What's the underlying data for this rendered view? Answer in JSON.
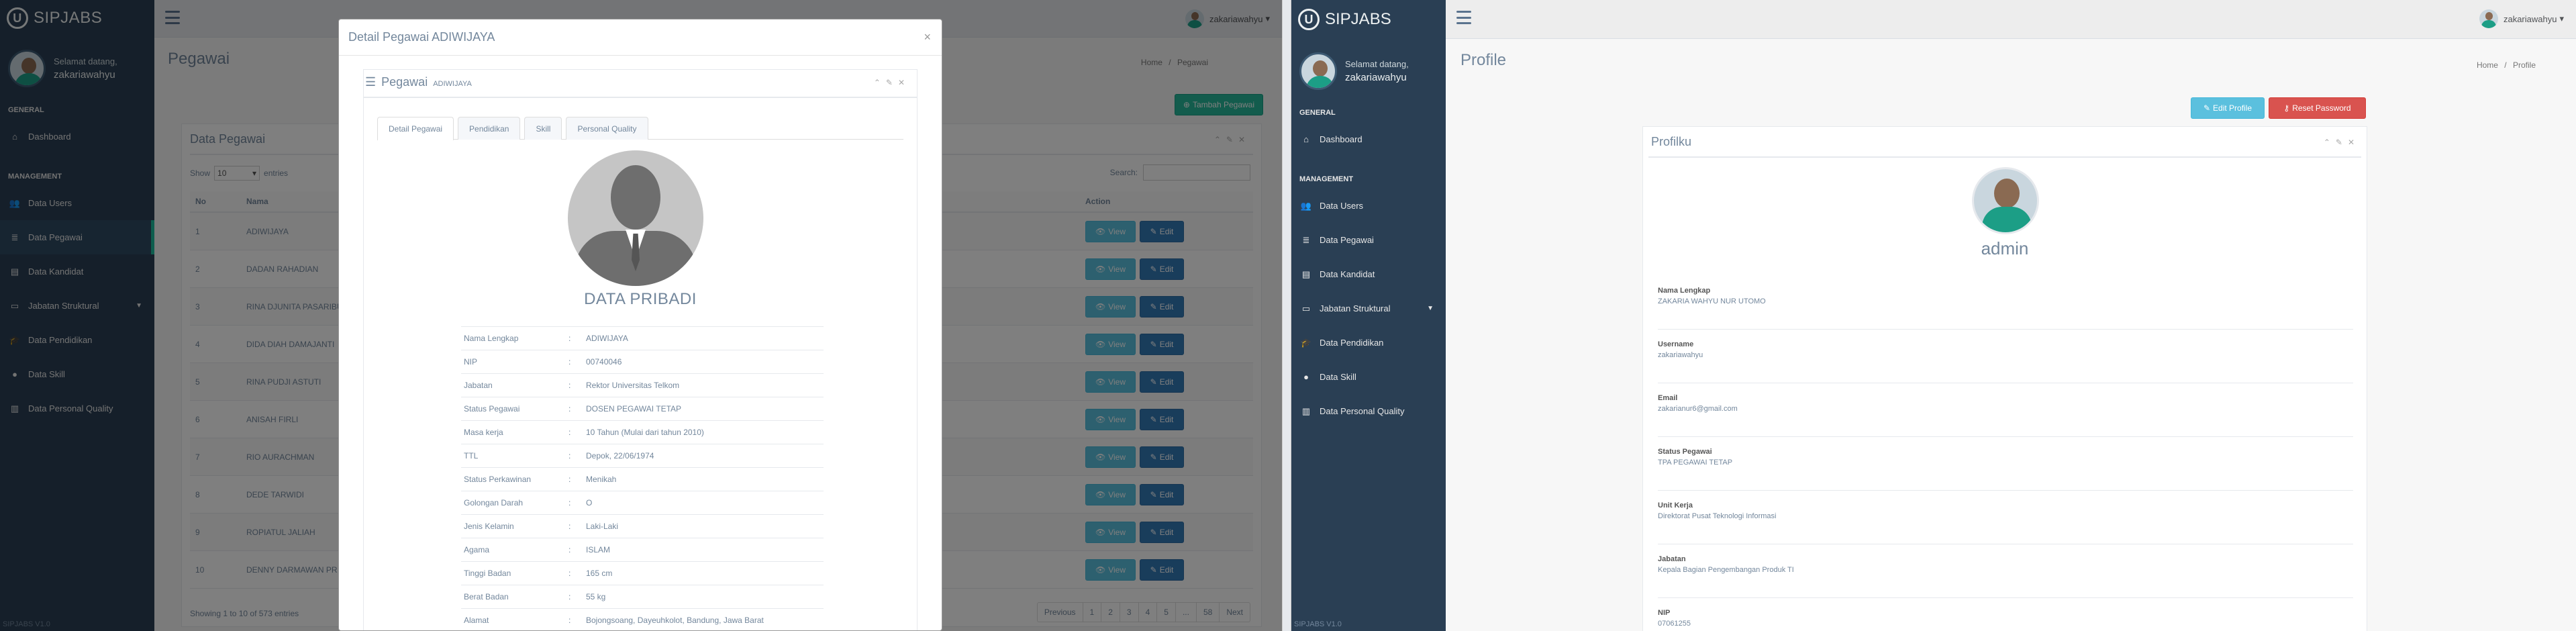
{
  "app": {
    "brand": "SIPJABS",
    "logo_letter": "U",
    "version": "SIPJABS V1.0",
    "welcome": "Selamat datang,",
    "username": "zakariawahyu"
  },
  "sidebar": {
    "section_general": "GENERAL",
    "section_management": "MANAGEMENT",
    "items": [
      {
        "label": "Dashboard",
        "icon": "home-icon"
      },
      {
        "label": "Data Users",
        "icon": "users-icon"
      },
      {
        "label": "Data Pegawai",
        "icon": "database-icon"
      },
      {
        "label": "Data Kandidat",
        "icon": "table-icon"
      },
      {
        "label": "Jabatan Struktural",
        "icon": "desktop-icon"
      },
      {
        "label": "Data Pendidikan",
        "icon": "graduation-cap-icon"
      },
      {
        "label": "Data Skill",
        "icon": "circle-icon"
      },
      {
        "label": "Data Personal Quality",
        "icon": "bar-chart-icon"
      }
    ]
  },
  "topbar": {
    "username": "zakariawahyu",
    "caret": "▾"
  },
  "left": {
    "page_title": "Pegawai",
    "breadcrumb_home": "Home",
    "breadcrumb_sep": "/",
    "breadcrumb_current": "Pegawai",
    "tambah_label": "Tambah Pegawai",
    "panel_title": "Data Pegawai",
    "show_label": "Show",
    "show_value": "10",
    "entries_label": "entries",
    "search_label": "Search:",
    "columns": {
      "no": "No",
      "nama": "Nama",
      "action": "Action"
    },
    "rows": [
      {
        "no": "1",
        "nama": "ADIWIJAYA"
      },
      {
        "no": "2",
        "nama": "DADAN RAHADIAN"
      },
      {
        "no": "3",
        "nama": "RINA DJUNITA PASARIBU"
      },
      {
        "no": "4",
        "nama": "DIDA DIAH DAMAJANTI"
      },
      {
        "no": "5",
        "nama": "RINA PUDJI ASTUTI"
      },
      {
        "no": "6",
        "nama": "ANISAH FIRLI"
      },
      {
        "no": "7",
        "nama": "RIO AURACHMAN"
      },
      {
        "no": "8",
        "nama": "DEDE TARWIDI"
      },
      {
        "no": "9",
        "nama": "ROPIATUL JALIAH"
      },
      {
        "no": "10",
        "nama": "DENNY DARMAWAN PR"
      }
    ],
    "view_label": "View",
    "edit_label": "Edit",
    "showing": "Showing 1 to 10 of 573 entries",
    "pager": [
      "Previous",
      "1",
      "2",
      "3",
      "4",
      "5",
      "...",
      "58",
      "Next"
    ]
  },
  "modal": {
    "title": "Detail Pegawai ADIWIJAYA",
    "close": "×",
    "panel_title": "Pegawai",
    "panel_subtitle": "ADIWIJAYA",
    "tabs": [
      "Detail Pegawai",
      "Pendidikan",
      "Skill",
      "Personal Quality"
    ],
    "section_title": "DATA PRIBADI",
    "sep": ":",
    "fields": [
      {
        "k": "Nama Lengkap",
        "v": "ADIWIJAYA"
      },
      {
        "k": "NIP",
        "v": "00740046"
      },
      {
        "k": "Jabatan",
        "v": "Rektor Universitas Telkom"
      },
      {
        "k": "Status Pegawai",
        "v": "DOSEN PEGAWAI TETAP"
      },
      {
        "k": "Masa kerja",
        "v": "10 Tahun (Mulai dari tahun 2010)"
      },
      {
        "k": "TTL",
        "v": "Depok, 22/06/1974"
      },
      {
        "k": "Status Perkawinan",
        "v": "Menikah"
      },
      {
        "k": "Golongan Darah",
        "v": "O"
      },
      {
        "k": "Jenis Kelamin",
        "v": "Laki-Laki"
      },
      {
        "k": "Agama",
        "v": "ISLAM"
      },
      {
        "k": "Tinggi Badan",
        "v": "165 cm"
      },
      {
        "k": "Berat Badan",
        "v": "55 kg"
      },
      {
        "k": "Alamat",
        "v": "Bojongsoang, Dayeuhkolot, Bandung, Jawa Barat"
      }
    ]
  },
  "right": {
    "page_title": "Profile",
    "breadcrumb_home": "Home",
    "breadcrumb_sep": "/",
    "breadcrumb_current": "Profile",
    "edit_profile_label": "Edit Profile",
    "reset_password_label": "Reset Password",
    "panel_title": "Profilku",
    "name": "admin",
    "fields": [
      {
        "label": "Nama Lengkap",
        "value": "ZAKARIA WAHYU NUR UTOMO"
      },
      {
        "label": "Username",
        "value": "zakariawahyu"
      },
      {
        "label": "Email",
        "value": "zakarianur6@gmail.com"
      },
      {
        "label": "Status Pegawai",
        "value": "TPA PEGAWAI TETAP"
      },
      {
        "label": "Unit Kerja",
        "value": "Direktorat Pusat Teknologi Informasi"
      },
      {
        "label": "Jabatan",
        "value": "Kepala Bagian Pengembangan Produk TI"
      },
      {
        "label": "NIP",
        "value": "07061255"
      }
    ]
  },
  "colors": {
    "sidebar": "#2a3f54",
    "accent": "#1abb9c",
    "btn_info": "#5bc0de",
    "btn_primary": "#337ab7",
    "btn_danger": "#d9534f",
    "btn_success": "#26b99a"
  }
}
